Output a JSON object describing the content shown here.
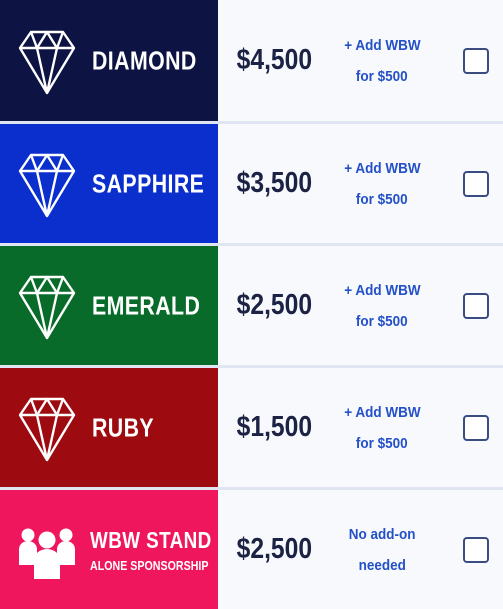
{
  "tiers": [
    {
      "name": "DIAMOND",
      "price": "$4,500",
      "addon_line1": "+ Add WBW",
      "addon_line2": "for $500",
      "color": "#0d1443",
      "icon": "diamond-icon",
      "checked": false
    },
    {
      "name": "SAPPHIRE",
      "price": "$3,500",
      "addon_line1": "+ Add WBW",
      "addon_line2": "for $500",
      "color": "#0b2fcc",
      "icon": "diamond-icon",
      "checked": false
    },
    {
      "name": "EMERALD",
      "price": "$2,500",
      "addon_line1": "+ Add WBW",
      "addon_line2": "for $500",
      "color": "#096b2a",
      "icon": "diamond-icon",
      "checked": false
    },
    {
      "name": "RUBY",
      "price": "$1,500",
      "addon_line1": "+ Add WBW",
      "addon_line2": "for $500",
      "color": "#9d0b10",
      "icon": "diamond-icon",
      "checked": false
    },
    {
      "name": "WBW STAND",
      "subname": "ALONE SPONSORSHIP",
      "price": "$2,500",
      "addon_line1": "No add-on",
      "addon_line2": "needed",
      "color": "#f0165e",
      "icon": "people-icon",
      "checked": false
    }
  ]
}
